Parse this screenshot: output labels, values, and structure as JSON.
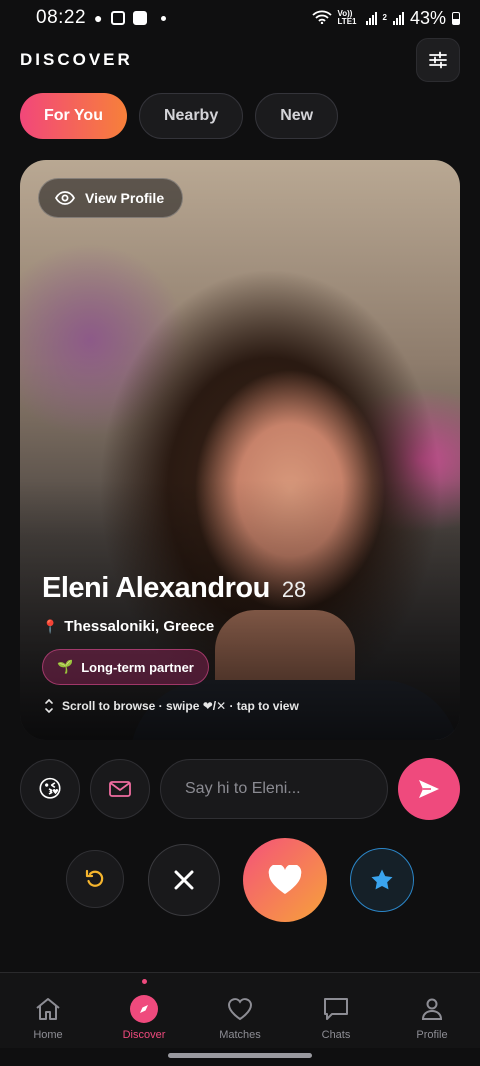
{
  "status": {
    "time": "08:22",
    "battery": "43%",
    "net1": "Vo)) LTE1",
    "sim2": "2"
  },
  "header": {
    "title": "DISCOVER"
  },
  "tabs": [
    {
      "label": "For You",
      "active": true
    },
    {
      "label": "Nearby",
      "active": false
    },
    {
      "label": "New",
      "active": false
    }
  ],
  "card": {
    "view_profile": "View Profile",
    "name": "Eleni Alexandrou",
    "age": "28",
    "location": "Thessaloniki, Greece",
    "tag": "Long-term partner",
    "hint": "Scroll to browse · swipe ❤/✕ · tap to view"
  },
  "composer": {
    "placeholder": "Say hi to Eleni..."
  },
  "nav": [
    {
      "label": "Home"
    },
    {
      "label": "Discover"
    },
    {
      "label": "Matches"
    },
    {
      "label": "Chats"
    },
    {
      "label": "Profile"
    }
  ],
  "colors": {
    "accent": "#ef4a7d",
    "gradient_start": "#f2477a",
    "gradient_end": "#f7803a",
    "super_like": "#2b86c8"
  }
}
